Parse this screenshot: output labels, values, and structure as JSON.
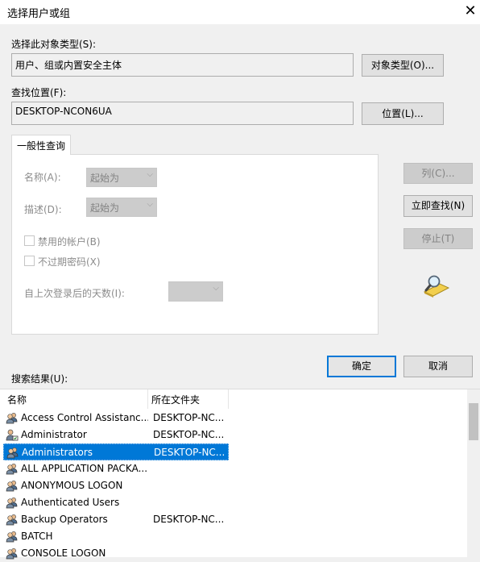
{
  "window": {
    "title": "选择用户或组",
    "close_glyph": "✕"
  },
  "object_type": {
    "label": "选择此对象类型(S):",
    "value": "用户、组或内置安全主体",
    "button": "对象类型(O)..."
  },
  "location": {
    "label": "查找位置(F):",
    "value": "DESKTOP-NCON6UA",
    "button": "位置(L)..."
  },
  "tab": {
    "label": "一般性查询"
  },
  "query": {
    "name_label": "名称(A):",
    "name_combo": "起始为",
    "desc_label": "描述(D):",
    "desc_combo": "起始为",
    "disabled_accounts": "禁用的帐户(B)",
    "no_expire_password": "不过期密码(X)",
    "days_label": "自上次登录后的天数(I):",
    "days_combo": ""
  },
  "side_buttons": {
    "columns": "列(C)...",
    "find_now": "立即查找(N)",
    "stop": "停止(T)"
  },
  "actions": {
    "ok": "确定",
    "cancel": "取消"
  },
  "results": {
    "label": "搜索结果(U):",
    "columns": [
      "名称",
      "所在文件夹"
    ],
    "rows": [
      {
        "name": "Access Control Assistanc...",
        "folder": "DESKTOP-NC...",
        "icon": "group-icon"
      },
      {
        "name": "Administrator",
        "folder": "DESKTOP-NC...",
        "icon": "user-icon"
      },
      {
        "name": "Administrators",
        "folder": "DESKTOP-NC...",
        "icon": "group-icon",
        "selected": true
      },
      {
        "name": "ALL APPLICATION PACKA...",
        "folder": "",
        "icon": "group-icon"
      },
      {
        "name": "ANONYMOUS LOGON",
        "folder": "",
        "icon": "group-icon"
      },
      {
        "name": "Authenticated Users",
        "folder": "",
        "icon": "group-icon"
      },
      {
        "name": "Backup Operators",
        "folder": "DESKTOP-NC...",
        "icon": "group-icon"
      },
      {
        "name": "BATCH",
        "folder": "",
        "icon": "group-icon"
      },
      {
        "name": "CONSOLE LOGON",
        "folder": "",
        "icon": "group-icon"
      }
    ]
  },
  "colors": {
    "accent": "#0078d7",
    "dialog_bg": "#f0f0f0"
  }
}
